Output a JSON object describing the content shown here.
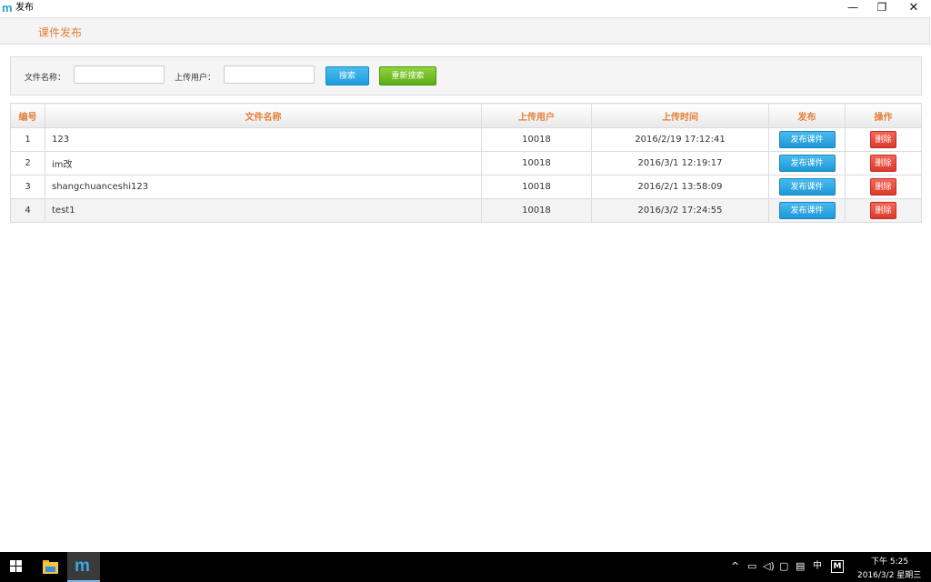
{
  "window": {
    "logo": "m",
    "title": "发布",
    "minimize": "—",
    "restore": "❐",
    "close": "✕"
  },
  "header": {
    "title": "课件发布"
  },
  "search": {
    "name_label": "文件名称：",
    "name_value": "",
    "user_label": "上传用户：",
    "user_value": "",
    "search_button": "搜索",
    "reset_button": "重新搜索"
  },
  "table": {
    "columns": [
      "编号",
      "文件名称",
      "上传用户",
      "上传时间",
      "发布",
      "操作"
    ],
    "rows": [
      {
        "id": "1",
        "name": "123",
        "user": "10018",
        "time": "2016/2/19 17:12:41",
        "publish": "发布课件",
        "delete": "删除"
      },
      {
        "id": "2",
        "name": "im改",
        "user": "10018",
        "time": "2016/3/1 12:19:17",
        "publish": "发布课件",
        "delete": "删除"
      },
      {
        "id": "3",
        "name": "shangchuanceshi123",
        "user": "10018",
        "time": "2016/2/1 13:58:09",
        "publish": "发布课件",
        "delete": "删除"
      },
      {
        "id": "4",
        "name": "test1",
        "user": "10018",
        "time": "2016/3/2 17:24:55",
        "publish": "发布课件",
        "delete": "删除"
      }
    ]
  },
  "taskbar": {
    "app_icon": "m",
    "tray": {
      "chevron": "^",
      "battery": "▭",
      "volume": "◁)",
      "network": "▢",
      "notifications": "▤",
      "ime": "中",
      "ime_mode": "M"
    },
    "time": "下午 5:25",
    "date": "2016/3/2 星期三"
  },
  "colors": {
    "accent_text": "#e3803a",
    "search_button": "#1f9bdc",
    "reset_button": "#5cab16",
    "publish_button": "#1f98d9",
    "delete_button": "#dc3a2c"
  }
}
